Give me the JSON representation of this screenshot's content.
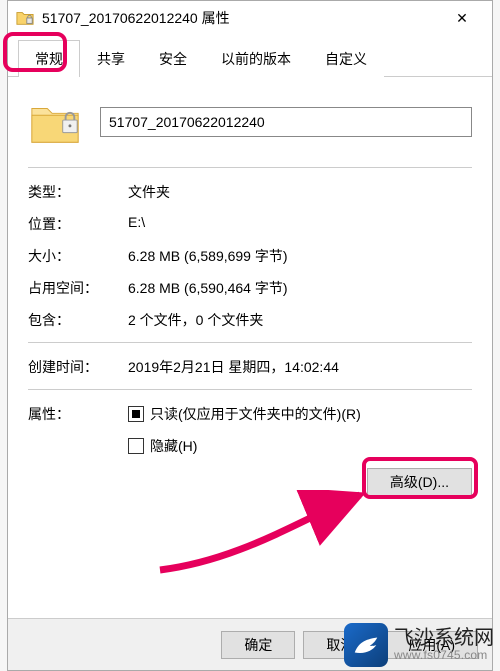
{
  "window": {
    "title": "51707_20170622012240 属性",
    "close_glyph": "✕"
  },
  "tabs": {
    "items": [
      {
        "label": "常规",
        "selected": true
      },
      {
        "label": "共享",
        "selected": false
      },
      {
        "label": "安全",
        "selected": false
      },
      {
        "label": "以前的版本",
        "selected": false
      },
      {
        "label": "自定义",
        "selected": false
      }
    ]
  },
  "name_value": "51707_20170622012240",
  "props": {
    "type_label": "类型：",
    "type_value": "文件夹",
    "location_label": "位置：",
    "location_value": "E:\\",
    "size_label": "大小：",
    "size_value": "6.28 MB (6,589,699 字节)",
    "ondisk_label": "占用空间：",
    "ondisk_value": "6.28 MB (6,590,464 字节)",
    "contains_label": "包含：",
    "contains_value": "2 个文件，0 个文件夹",
    "created_label": "创建时间：",
    "created_value": "2019年2月21日 星期四，14:02:44",
    "attrs_label": "属性：",
    "readonly_label": "只读(仅应用于文件夹中的文件)(R)",
    "hidden_label": "隐藏(H)",
    "advanced_label": "高级(D)..."
  },
  "buttons": {
    "ok": "确定",
    "cancel": "取消",
    "apply": "应用(A)"
  },
  "watermark": {
    "cn": "飞沙系统网",
    "url": "www.fs0745.com"
  }
}
